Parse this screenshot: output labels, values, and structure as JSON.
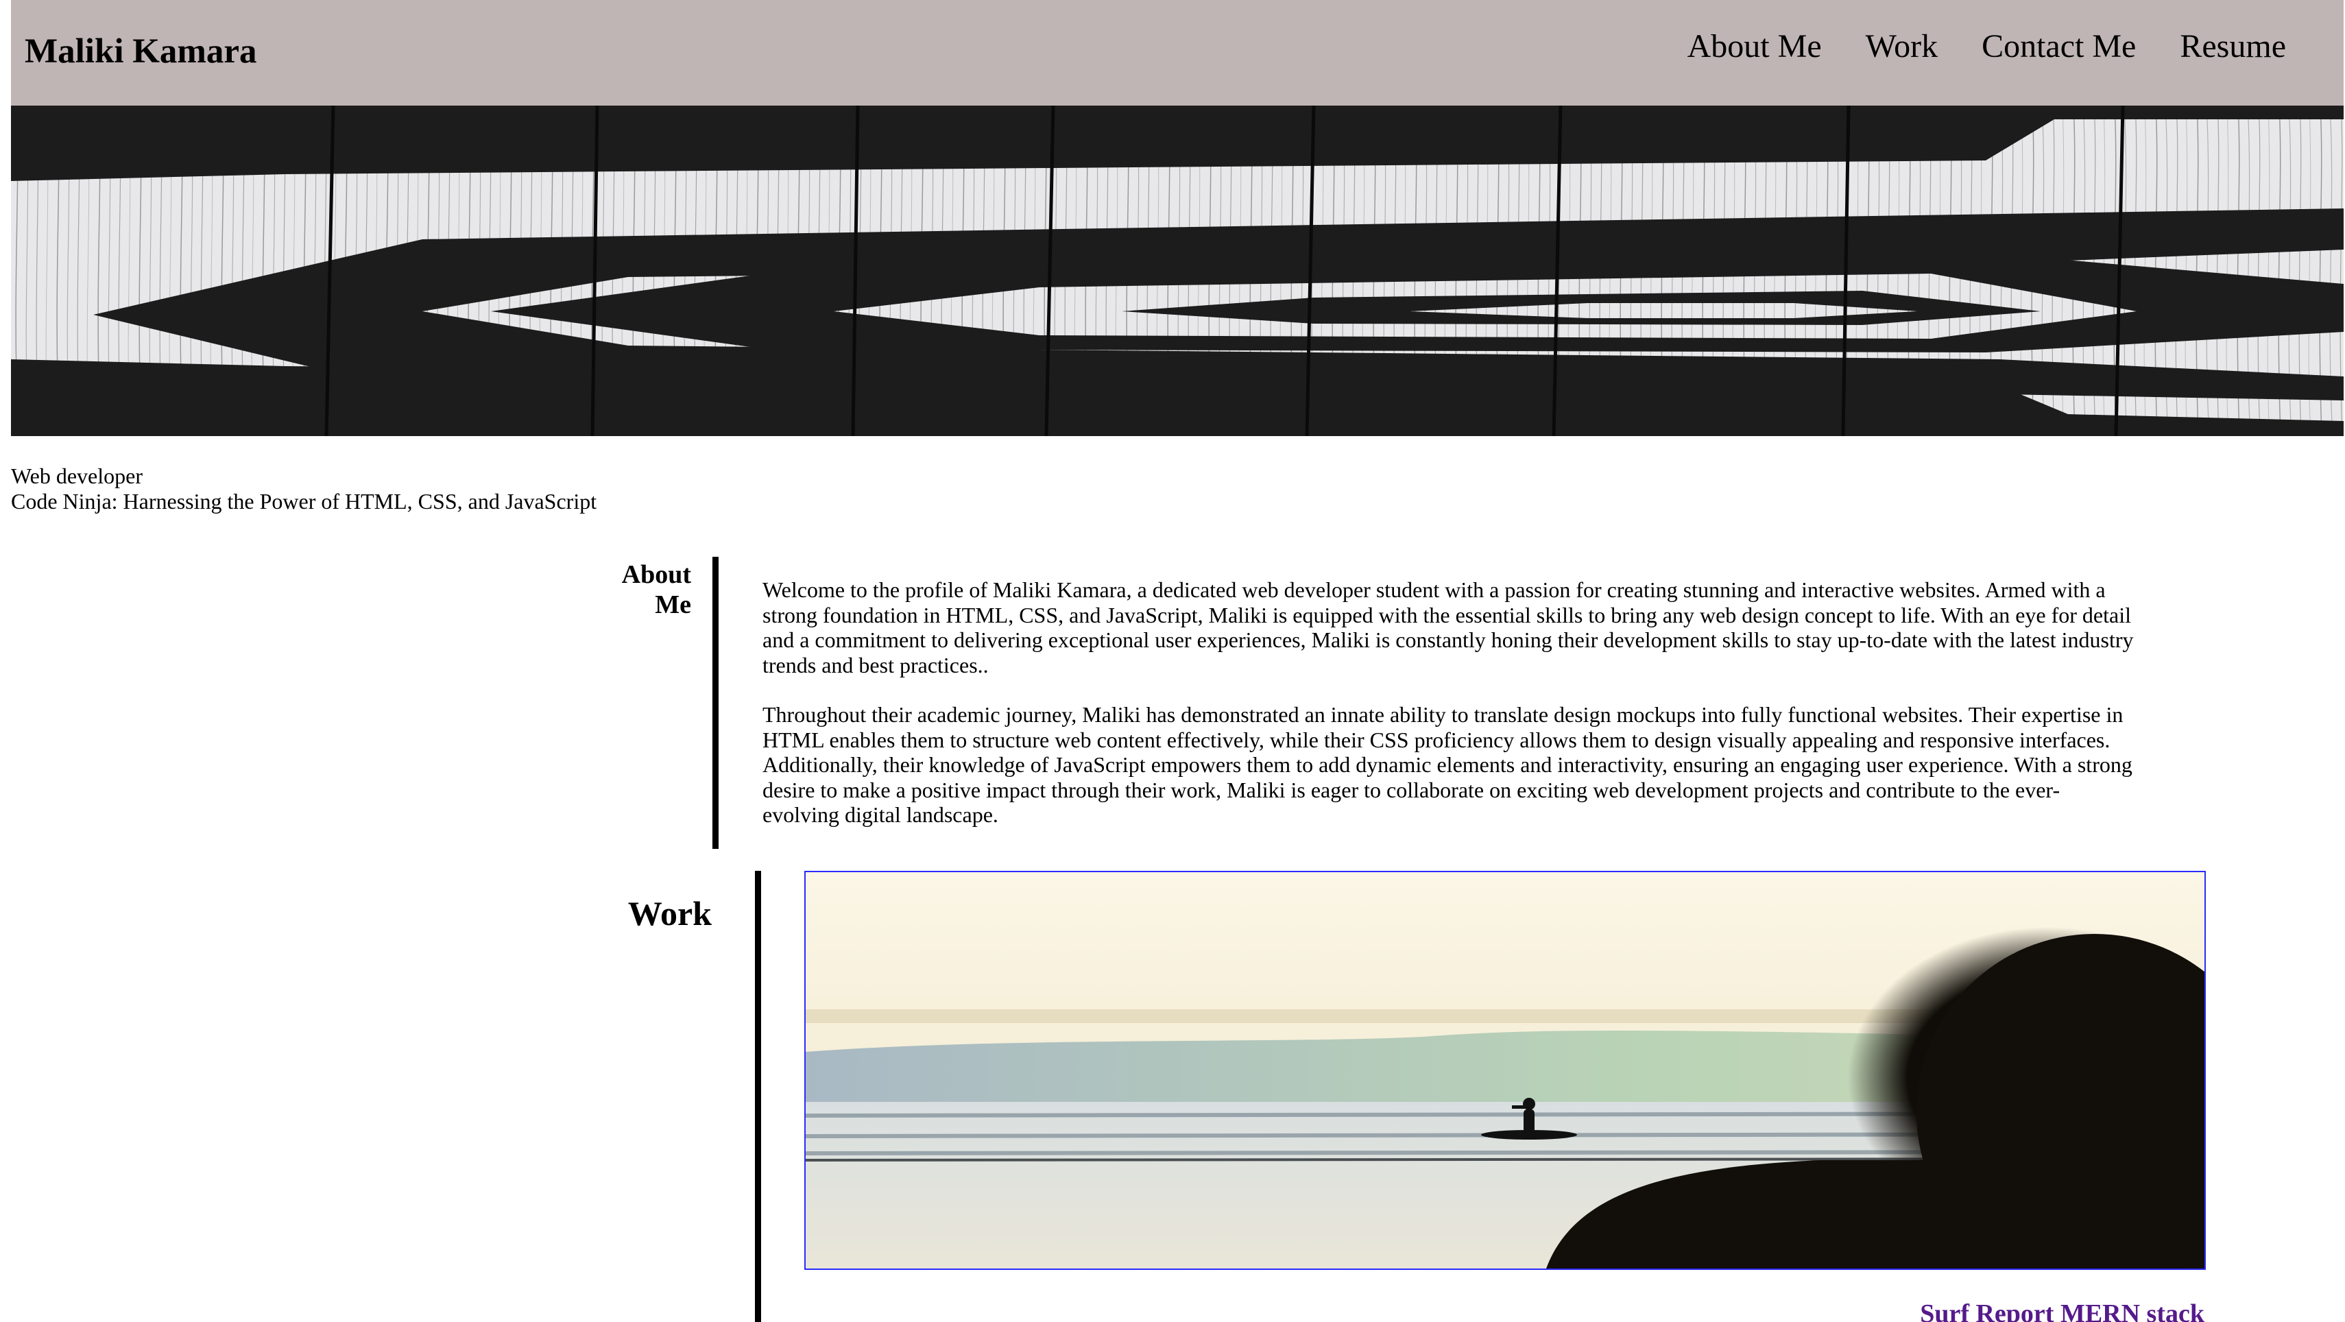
{
  "header": {
    "site_title": "Maliki Kamara",
    "nav": [
      {
        "label": "About Me"
      },
      {
        "label": "Work"
      },
      {
        "label": "Contact Me"
      },
      {
        "label": "Resume"
      }
    ],
    "background_color": "#bfb5b4"
  },
  "hero": {
    "image": "black-and-white-carved-wood-pattern"
  },
  "tagline": {
    "line1": "Web developer",
    "line2": "Code Ninja: Harnessing the Power of HTML, CSS, and JavaScript"
  },
  "about": {
    "heading": "About Me",
    "paragraphs": [
      "Welcome to the profile of Maliki Kamara, a dedicated web developer student with a passion for creating stunning and interactive websites. Armed with a strong foundation in HTML, CSS, and JavaScript, Maliki is equipped with the essential skills to bring any web design concept to life. With an eye for detail and a commitment to delivering exceptional user experiences, Maliki is constantly honing their development skills to stay up-to-date with the latest industry trends and best practices..",
      "Throughout their academic journey, Maliki has demonstrated an innate ability to translate design mockups into fully functional websites. Their expertise in HTML enables them to structure web content effectively, while their CSS proficiency allows them to design visually appealing and responsive interfaces. Additionally, their knowledge of JavaScript empowers them to add dynamic elements and interactivity, ensuring an engaging user experience. With a strong desire to make a positive impact through their work, Maliki is eager to collaborate on exciting web development projects and contribute to the ever-evolving digital landscape."
    ]
  },
  "work": {
    "heading": "Work",
    "projects": [
      {
        "image": "surfer-at-sunset-beach-photo",
        "link_label": "Surf Report MERN stack",
        "link_color": "#551a8b"
      }
    ]
  }
}
